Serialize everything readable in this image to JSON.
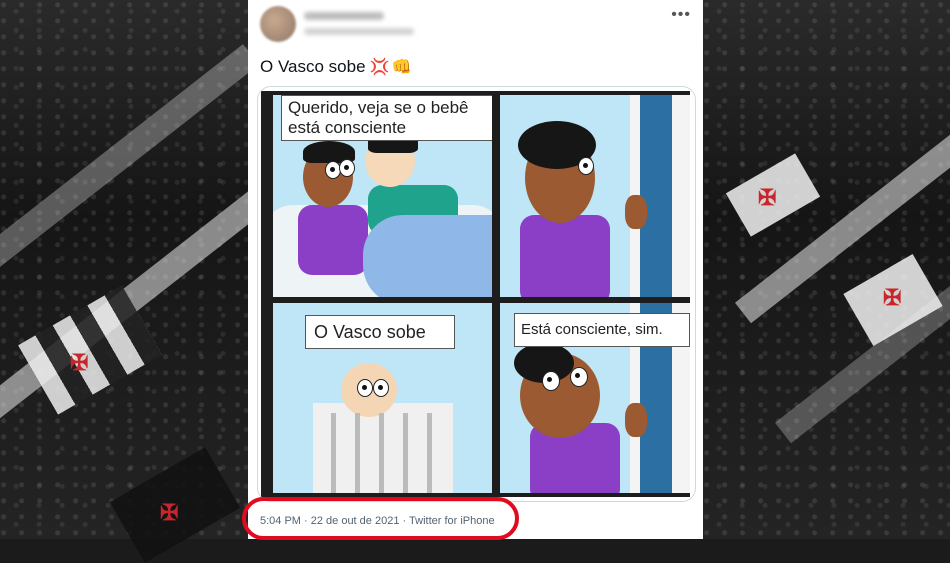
{
  "tweet": {
    "more_icon": "more-horizontal-icon",
    "text": "O Vasco sobe",
    "emojis": [
      "anger-symbol-emoji",
      "fist-emoji"
    ],
    "comic": {
      "panel1_caption": "Querido, veja se o bebê está consciente",
      "panel3_caption": "O Vasco sobe",
      "panel4_caption": "Está consciente, sim."
    },
    "meta": "5:04 PM · 22 de out de 2021 · Twitter for iPhone"
  },
  "colors": {
    "highlight": "#e10b1f",
    "meta_text": "#536471",
    "shirt": "#8a3fc6"
  }
}
